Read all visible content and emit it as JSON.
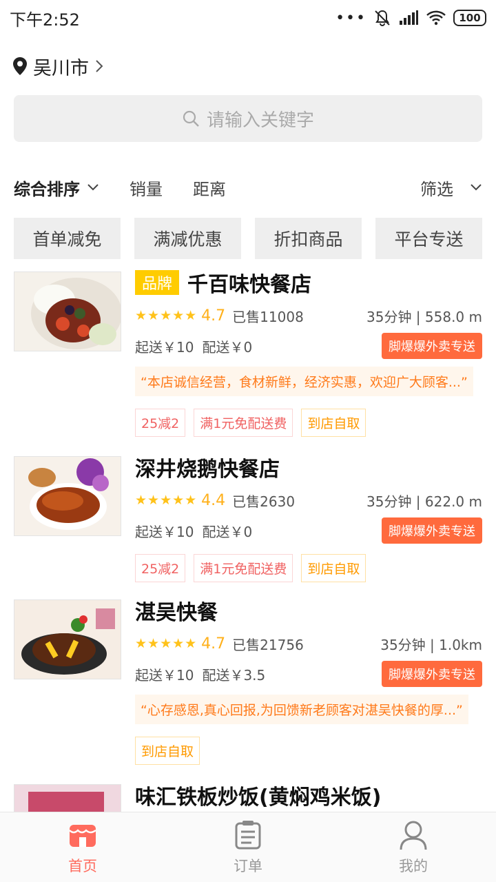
{
  "status_bar": {
    "time": "下午2:52",
    "dots": "•••",
    "battery": "100"
  },
  "location": {
    "city": "吴川市"
  },
  "search": {
    "placeholder": "请输入关键字"
  },
  "sort_bar": {
    "items": [
      "综合排序",
      "销量",
      "距离"
    ],
    "filter": "筛选"
  },
  "tags": [
    "首单减免",
    "满减优惠",
    "折扣商品",
    "平台专送"
  ],
  "shops": [
    {
      "brand_badge": "品牌",
      "name": "千百味快餐店",
      "rating": "4.7",
      "sold": "已售11008",
      "eta": "35分钟 | 558.0 m",
      "min_order": "起送￥10",
      "delivery_fee": "配送￥0",
      "delivery_badge": "脚爆爆外卖专送",
      "notice": "“本店诚信经营，食材新鲜，经济实惠，欢迎广大顾客...”",
      "promos": [
        "25减2",
        "满1元免配送费",
        "到店自取"
      ]
    },
    {
      "name": "深井烧鹅快餐店",
      "rating": "4.4",
      "sold": "已售2630",
      "eta": "35分钟 | 622.0 m",
      "min_order": "起送￥10",
      "delivery_fee": "配送￥0",
      "delivery_badge": "脚爆爆外卖专送",
      "promos": [
        "25减2",
        "满1元免配送费",
        "到店自取"
      ]
    },
    {
      "name": "湛吴快餐",
      "rating": "4.7",
      "sold": "已售21756",
      "eta": "35分钟 | 1.0km",
      "min_order": "起送￥10",
      "delivery_fee": "配送￥3.5",
      "delivery_badge": "脚爆爆外卖专送",
      "notice": "“心存感恩,真心回报,为回馈新老顾客对湛吴快餐的厚...”",
      "promos": [
        "到店自取"
      ]
    },
    {
      "name": "味汇铁板炒饭(黄焖鸡米饭)"
    }
  ],
  "bottom_nav": [
    {
      "label": "首页",
      "icon": "shop-icon",
      "active": true
    },
    {
      "label": "订单",
      "icon": "clipboard-icon",
      "active": false
    },
    {
      "label": "我的",
      "icon": "user-icon",
      "active": false
    }
  ],
  "colors": {
    "accent": "#ff6b5e",
    "rating": "#ffb01a",
    "brand_badge": "#ffcc00",
    "delivery_badge": "#ff6a3d"
  }
}
